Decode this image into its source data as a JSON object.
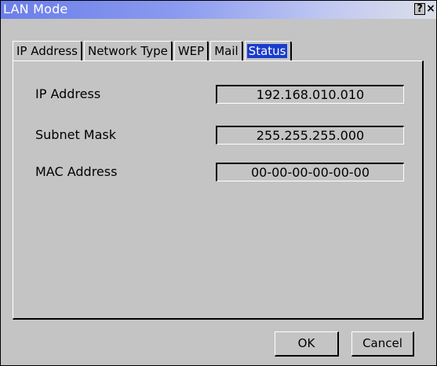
{
  "window": {
    "title": "LAN Mode",
    "help_glyph": "?",
    "close_glyph": "×"
  },
  "tabs": [
    {
      "label": "IP Address"
    },
    {
      "label": "Network Type"
    },
    {
      "label": "WEP"
    },
    {
      "label": "Mail"
    },
    {
      "label": "Status",
      "active": true
    }
  ],
  "status": {
    "ip_address": {
      "label": "IP Address",
      "value": "192.168.010.010"
    },
    "subnet_mask": {
      "label": "Subnet Mask",
      "value": "255.255.255.000"
    },
    "mac_address": {
      "label": "MAC Address",
      "value": "00-00-00-00-00-00"
    }
  },
  "buttons": {
    "ok": "OK",
    "cancel": "Cancel"
  },
  "colors": {
    "titlebar_start": "#6b7ee9",
    "titlebar_end": "#dcdfe9",
    "active_tab_highlight": "#1a3ccd",
    "background": "#c4c4c4"
  }
}
